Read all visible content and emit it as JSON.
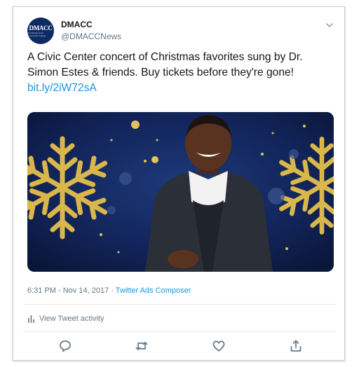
{
  "tweet": {
    "author": {
      "name": "DMACC",
      "handle": "@DMACCNews",
      "avatar_label": "DMACC",
      "avatar_sublabel": "Des Moines Area Community College"
    },
    "text": "A Civic Center concert of Christmas favorites sung by Dr. Simon Estes & friends. Buy tickets before they're gone!",
    "link": "bit.ly/2iW72sA",
    "timestamp": "6:31 PM - Nov 14, 2017",
    "source": "Twitter Ads Composer",
    "activity_label": "View Tweet activity",
    "icons": {
      "menu": "chevron-down-icon",
      "activity": "bar-chart-icon",
      "reply": "reply-icon",
      "retweet": "retweet-icon",
      "like": "heart-icon",
      "share": "share-icon"
    },
    "colors": {
      "link": "#1b95e0",
      "muted": "#657786",
      "text": "#14171a",
      "image_background": "#0f1d4a",
      "snowflake_gold": "#d9b74a"
    }
  }
}
